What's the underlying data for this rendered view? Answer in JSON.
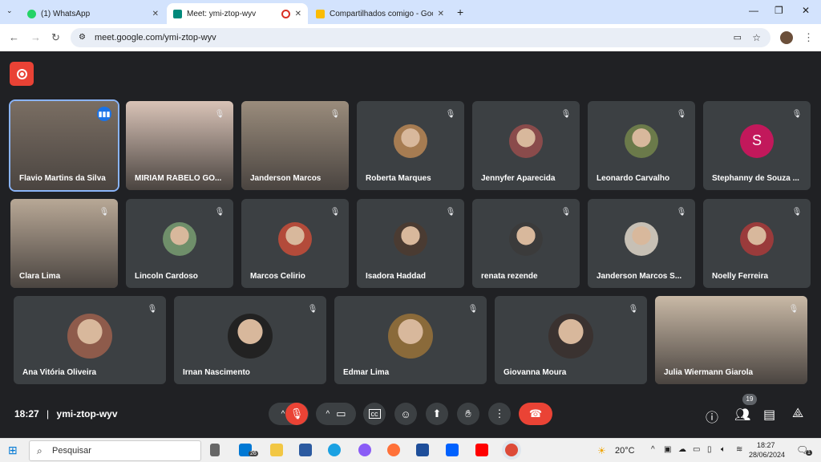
{
  "browser": {
    "tabs": [
      {
        "title": "(1) WhatsApp",
        "color": "#25d366"
      },
      {
        "title": "Meet: ymi-ztop-wyv",
        "color": "#00897b"
      },
      {
        "title": "Compartilhados comigo - Goog",
        "color": "#fbbc04"
      }
    ],
    "new_tab": "+",
    "url": "meet.google.com/ymi-ztop-wyv"
  },
  "meet": {
    "participants": [
      {
        "name": "Flavio Martins da Silva",
        "speaking": true
      },
      {
        "name": "MIRIAM RABELO GO..."
      },
      {
        "name": "Janderson Marcos"
      },
      {
        "name": "Roberta Marques"
      },
      {
        "name": "Jennyfer Aparecida"
      },
      {
        "name": "Leonardo Carvalho"
      },
      {
        "name": "Stephanny de Souza ...",
        "initial": "S"
      },
      {
        "name": "Clara Lima"
      },
      {
        "name": "Lincoln Cardoso"
      },
      {
        "name": "Marcos Celirio"
      },
      {
        "name": "Isadora Haddad"
      },
      {
        "name": "renata rezende"
      },
      {
        "name": "Janderson Marcos S..."
      },
      {
        "name": "Noelly Ferreira"
      },
      {
        "name": "Ana Vitória Oliveira"
      },
      {
        "name": "Irnan Nascimento"
      },
      {
        "name": "Edmar Lima"
      },
      {
        "name": "Giovanna Moura"
      },
      {
        "name": "Julia Wiermann Giarola"
      }
    ],
    "clock": "18:27",
    "separator": "|",
    "meeting_code": "ymi-ztop-wyv",
    "people_count": "19"
  },
  "taskbar": {
    "search_placeholder": "Pesquisar",
    "mail_badge": "26",
    "weather": "20°C",
    "time": "18:27",
    "date": "28/06/2024",
    "notif": "1"
  }
}
